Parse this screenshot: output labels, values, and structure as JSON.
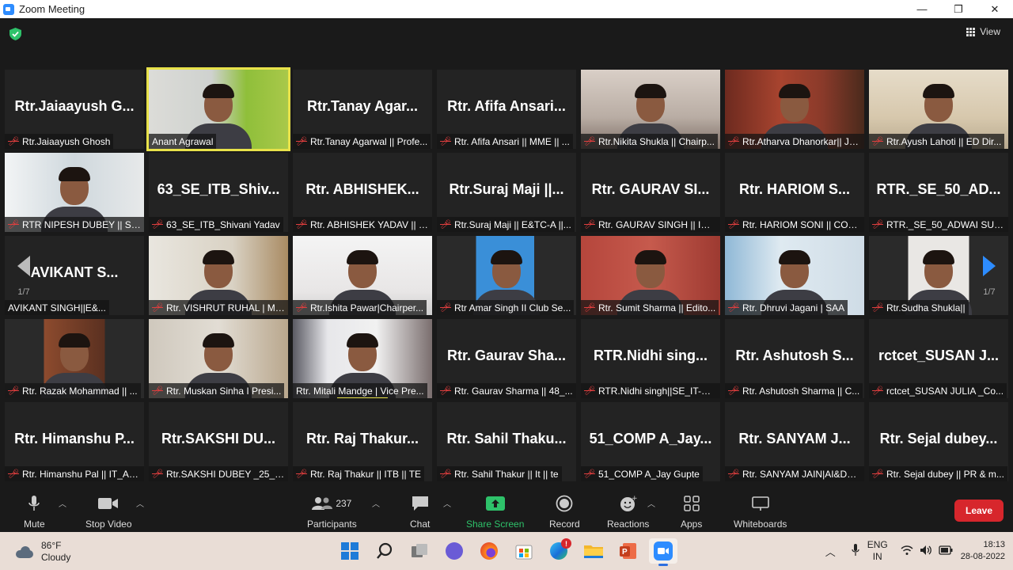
{
  "window": {
    "title": "Zoom Meeting",
    "controls": [
      "—",
      "❐",
      "✕"
    ]
  },
  "view_button": "View",
  "pagination": {
    "left": "1/7",
    "right": "1/7"
  },
  "tiles": [
    {
      "big": "Rtr.Jaiaayush  G...",
      "label": "Rtr.Jaiaayush Ghosh",
      "muted": true,
      "video": false
    },
    {
      "big": "",
      "label": "Anant Agrawal",
      "muted": false,
      "video": true,
      "scene": "office",
      "active": true
    },
    {
      "big": "Rtr.Tanay  Agar...",
      "label": "Rtr.Tanay Agarwal || Profe...",
      "muted": true,
      "video": false
    },
    {
      "big": "Rtr.  Afifa  Ansari...",
      "label": "Rtr. Afifa Ansari || MME || ...",
      "muted": true,
      "video": false
    },
    {
      "big": "",
      "label": "Rtr.Nikita Shukla || Chairp...",
      "muted": true,
      "video": true,
      "scene": "face-light"
    },
    {
      "big": "",
      "label": "Rtr.Atharva Dhanorkar|| Jt. S...",
      "muted": true,
      "video": true,
      "scene": "face-red"
    },
    {
      "big": "",
      "label": "Rtr.Ayush Lahoti || ED Dir...",
      "muted": true,
      "video": true,
      "scene": "face-beige"
    },
    {
      "big": "",
      "label": "RTR NIPESH DUBEY || SEC...",
      "muted": true,
      "video": true,
      "scene": "face-window"
    },
    {
      "big": "63_SE_ITB_Shiv...",
      "label": "63_SE_ITB_Shivani Yadav",
      "muted": true,
      "video": false
    },
    {
      "big": "Rtr.  ABHISHEK...",
      "label": "Rtr. ABHISHEK YADAV || I...",
      "muted": true,
      "video": false
    },
    {
      "big": "Rtr.Suraj  Maji  ||...",
      "label": "Rtr.Suraj Maji || E&TC-A ||...",
      "muted": true,
      "video": false
    },
    {
      "big": "Rtr.  GAURAV  SI...",
      "label": "Rtr. GAURAV SINGH || IOT...",
      "muted": true,
      "video": false
    },
    {
      "big": "Rtr.  HARIOM  S...",
      "label": "Rtr. HARIOM SONI || COM...",
      "muted": true,
      "video": false
    },
    {
      "big": "RTR._SE_50_AD...",
      "label": "RTR._SE_50_ADWAI SURVE",
      "muted": true,
      "video": false
    },
    {
      "big": "AVIKANT  S...",
      "label": "AVIKANT SINGH||E&...",
      "muted": false,
      "video": false
    },
    {
      "big": "",
      "label": "Rtr. VISHRUT RUHAL | ME...",
      "muted": true,
      "video": true,
      "scene": "face-room"
    },
    {
      "big": "",
      "label": "Rtr.Ishita Pawar|Chairper...",
      "muted": true,
      "video": true,
      "scene": "face-white"
    },
    {
      "big": "",
      "label": "Rtr Amar Singh II Club Se...",
      "muted": true,
      "video": true,
      "scene": "face-blue"
    },
    {
      "big": "",
      "label": "Rtr. Sumit Sharma || Edito...",
      "muted": true,
      "video": true,
      "scene": "face-red2"
    },
    {
      "big": "",
      "label": "Rtr. Dhruvi Jagani | SAA",
      "muted": true,
      "video": true,
      "scene": "face-bluewall"
    },
    {
      "big": "",
      "label": "Rtr.Sudha Shukla||",
      "muted": true,
      "video": true,
      "scene": "face-white2"
    },
    {
      "big": "",
      "label": "Rtr. Razak Mohammad || ...",
      "muted": true,
      "video": true,
      "scene": "face-dark"
    },
    {
      "big": "",
      "label": "Rtr. Muskan Sinha I Presi...",
      "muted": true,
      "video": true,
      "scene": "face-plants"
    },
    {
      "big": "",
      "label": "Rtr. Mitali Mandge | Vice Pre...",
      "muted": false,
      "video": true,
      "scene": "face-curtain",
      "speaking": true
    },
    {
      "big": "Rtr.  Gaurav  Sha...",
      "label": "Rtr. Gaurav Sharma || 48_...",
      "muted": true,
      "video": false
    },
    {
      "big": "RTR.Nidhi  sing...",
      "label": "RTR.Nidhi singh||SE_IT-B_...",
      "muted": true,
      "video": false
    },
    {
      "big": "Rtr.  Ashutosh  S...",
      "label": "Rtr. Ashutosh Sharma || C...",
      "muted": true,
      "video": false
    },
    {
      "big": "rctcet_SUSAN  J...",
      "label": "rctcet_SUSAN JULIA _Co...",
      "muted": true,
      "video": false
    },
    {
      "big": "Rtr.  Himanshu  P...",
      "label": "Rtr. Himanshu Pal || IT_A_...",
      "muted": true,
      "video": false
    },
    {
      "big": "Rtr.SAKSHI  DU...",
      "label": "Rtr.SAKSHI DUBEY _25_IT...",
      "muted": true,
      "video": false
    },
    {
      "big": "Rtr.  Raj  Thakur...",
      "label": "Rtr. Raj Thakur || ITB || TE",
      "muted": true,
      "video": false
    },
    {
      "big": "Rtr.  Sahil  Thaku...",
      "label": "Rtr. Sahil Thakur || It || te",
      "muted": true,
      "video": false
    },
    {
      "big": "51_COMP  A_Jay...",
      "label": "51_COMP A_Jay Gupte",
      "muted": true,
      "video": false
    },
    {
      "big": "Rtr.  SANYAM  J...",
      "label": "Rtr. SANYAM JAIN|AI&DS...",
      "muted": true,
      "video": false
    },
    {
      "big": "Rtr.  Sejal  dubey...",
      "label": "Rtr. Sejal dubey || PR & m...",
      "muted": true,
      "video": false
    }
  ],
  "toolbar": {
    "mute": "Mute",
    "stop_video": "Stop Video",
    "participants": "Participants",
    "participants_count": "237",
    "chat": "Chat",
    "share_screen": "Share Screen",
    "record": "Record",
    "reactions": "Reactions",
    "apps": "Apps",
    "whiteboards": "Whiteboards",
    "leave": "Leave"
  },
  "taskbar": {
    "weather_temp": "86°F",
    "weather_desc": "Cloudy",
    "lang_1": "ENG",
    "lang_2": "IN",
    "time": "18:13",
    "date": "28-08-2022",
    "notification_badge": "!"
  },
  "colors": {
    "accent": "#2d8cff",
    "active_speaker": "#e8e24a",
    "share_green": "#2ec26a",
    "leave_red": "#d7262c",
    "muted_red": "#e03e3e"
  }
}
